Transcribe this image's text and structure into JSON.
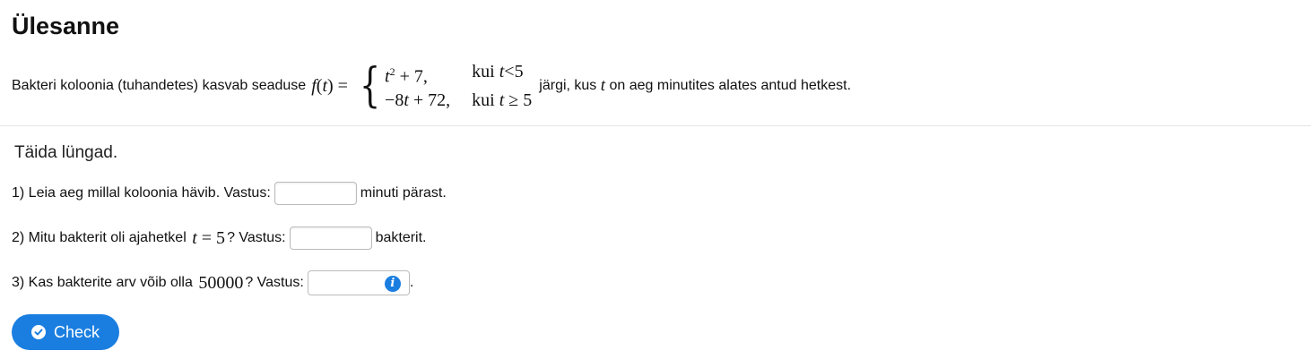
{
  "title": "Ülesanne",
  "statement": {
    "before": "Bakteri koloonia (tuhandetes) kasvab seaduse",
    "fx": {
      "f": "f",
      "open": "(",
      "t": "t",
      "close": ")",
      "eq": "="
    },
    "case1": {
      "base": "t",
      "exp": "2",
      "rest": " + 7,",
      "cond_prefix": "kui ",
      "cond_var": "t",
      "cond_rest": "<5"
    },
    "case2": {
      "expr_a": "−8",
      "var": "t",
      "expr_b": " + 72,",
      "cond_prefix": "kui ",
      "cond_var": "t",
      "cond_rest": " ≥  5"
    },
    "mid": "järgi, kus",
    "var": "t",
    "after": "on aeg minutites alates antud hetkest."
  },
  "instruction": "Täida lüngad.",
  "questions": {
    "q1": {
      "text": "1) Leia aeg millal koloonia hävib. Vastus:",
      "suffix": "minuti pärast.",
      "value": ""
    },
    "q2": {
      "text_before": "2) Mitu bakterit oli ajahetkel",
      "math_var": "t",
      "math_rest": " = 5",
      "text_after": "? Vastus:",
      "suffix": "bakterit.",
      "value": ""
    },
    "q3": {
      "text_before": "3) Kas bakterite arv võib olla",
      "math_num": "50000",
      "text_after": "? Vastus:",
      "suffix": ".",
      "info_icon": "info-icon"
    }
  },
  "check_button": {
    "label": "Check",
    "icon": "check-circle-icon",
    "color": "#1a7ee0"
  }
}
